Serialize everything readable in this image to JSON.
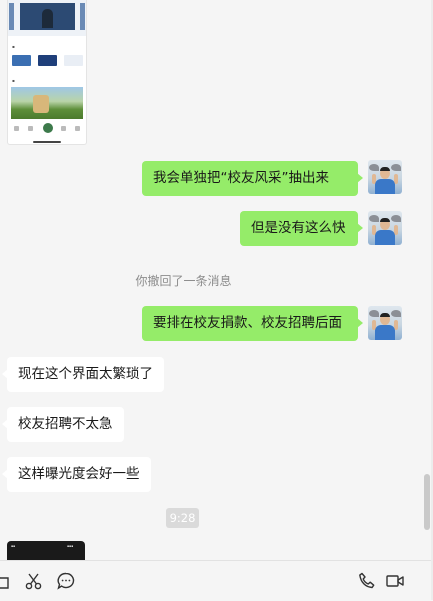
{
  "messages": [
    {
      "side": "me",
      "text": "我会单独把“校友风采”抽出来"
    },
    {
      "side": "me",
      "text": "但是没有这么快"
    },
    {
      "type": "system",
      "text": "你撤回了一条消息"
    },
    {
      "side": "me",
      "text": "要排在校友捐款、校友招聘后面"
    },
    {
      "side": "them",
      "text": "现在这个界面太繁琐了"
    },
    {
      "side": "them",
      "text": "校友招聘不太急"
    },
    {
      "side": "them",
      "text": "这样曝光度会好一些"
    }
  ],
  "timestamp": "9:28",
  "toolbar": {
    "left_icons": [
      "folder-icon",
      "scissors-icon",
      "chat-bubble-icon"
    ],
    "right_icons": [
      "phone-icon",
      "video-call-icon"
    ]
  },
  "colors": {
    "my_bubble": "#95ec69",
    "their_bubble": "#ffffff",
    "background": "#f5f5f5"
  }
}
